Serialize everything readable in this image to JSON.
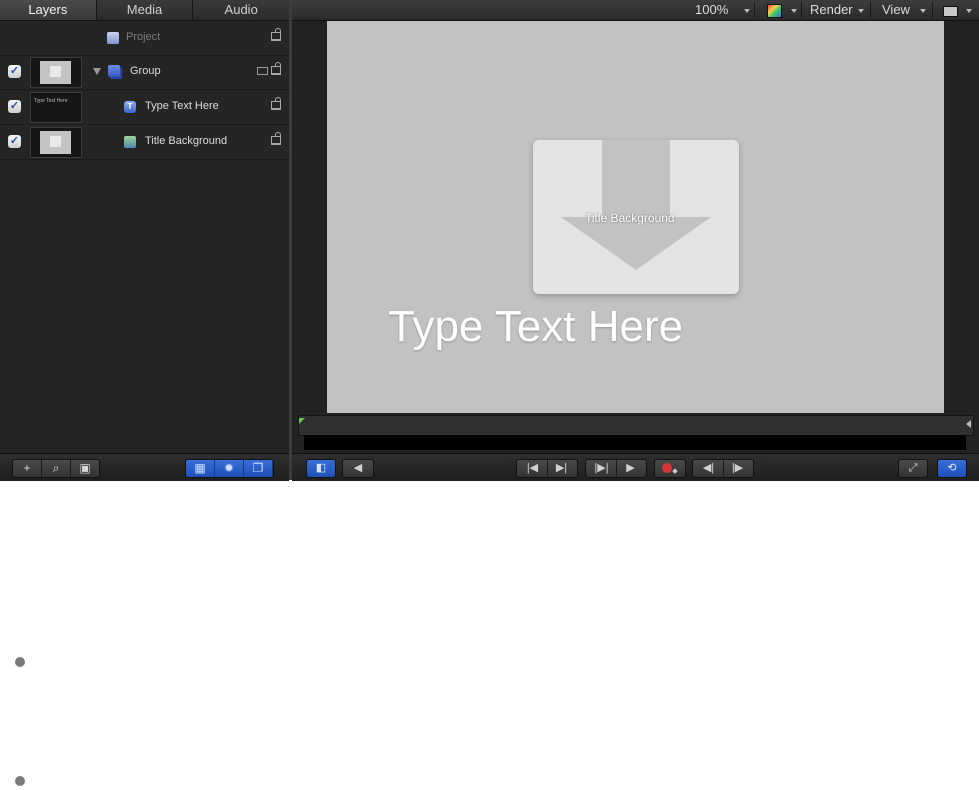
{
  "tabs": [
    "Layers",
    "Media",
    "Audio"
  ],
  "layers": {
    "project": "Project",
    "group": "Group",
    "text_layer": "Type Text Here",
    "bg_layer": "Title Background",
    "thumb_text": "Type Text Here"
  },
  "left_toolbar": {
    "add": "+",
    "search": "⌕",
    "pane": "▣",
    "view1": "▦",
    "view2": "✹",
    "view3": "❐"
  },
  "canvas_toolbar": {
    "zoom": "100%",
    "render": "Render",
    "view": "View"
  },
  "canvas": {
    "shape_label": "Title Background",
    "main_text": "Type Text Here"
  },
  "transport": {
    "left_a": "◧",
    "left_b": "◀",
    "to_start": "|◀",
    "to_end": "▶|",
    "play_range": "|▶|",
    "play": "▶",
    "rec_opt": "◆",
    "prev_frame": "◀|",
    "next_frame": "|▶",
    "fullscreen": "⤢",
    "loop": "⟲"
  },
  "colors": {
    "accent": "#2a5ed0",
    "canvas": "#c2c2c2",
    "panel": "#252525"
  }
}
